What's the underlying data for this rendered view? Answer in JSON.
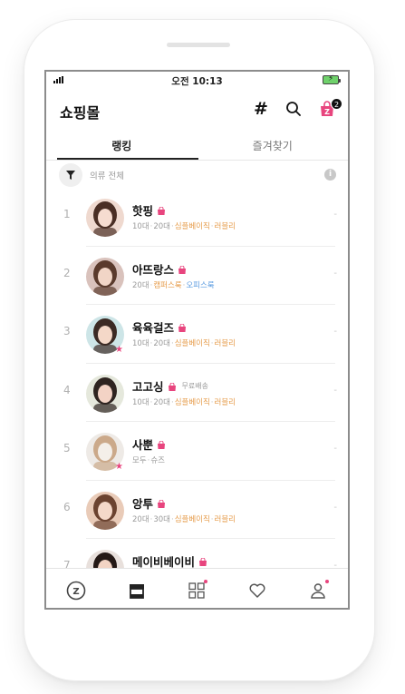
{
  "status_bar": {
    "time": "오전 10:13"
  },
  "header": {
    "title": "쇼핑몰",
    "cart_count": "2"
  },
  "tabs": [
    {
      "label": "랭킹",
      "active": true
    },
    {
      "label": "즐겨찾기",
      "active": false
    }
  ],
  "filter": {
    "label": "의류 전체"
  },
  "stores": [
    {
      "rank": "1",
      "name": "핫핑",
      "free_shipping": "",
      "star": false,
      "tags": [
        {
          "text": "10대",
          "color": "grey"
        },
        {
          "text": "20대",
          "color": "grey"
        },
        {
          "text": "심플베이직",
          "color": "orange"
        },
        {
          "text": "러블리",
          "color": "orange"
        }
      ]
    },
    {
      "rank": "2",
      "name": "아뜨랑스",
      "free_shipping": "",
      "star": false,
      "tags": [
        {
          "text": "20대",
          "color": "grey"
        },
        {
          "text": "캠퍼스룩",
          "color": "orange"
        },
        {
          "text": "오피스룩",
          "color": "blue"
        }
      ]
    },
    {
      "rank": "3",
      "name": "육육걸즈",
      "free_shipping": "",
      "star": true,
      "tags": [
        {
          "text": "10대",
          "color": "grey"
        },
        {
          "text": "20대",
          "color": "grey"
        },
        {
          "text": "심플베이직",
          "color": "orange"
        },
        {
          "text": "러블리",
          "color": "orange"
        }
      ]
    },
    {
      "rank": "4",
      "name": "고고싱",
      "free_shipping": "무료배송",
      "star": false,
      "tags": [
        {
          "text": "10대",
          "color": "grey"
        },
        {
          "text": "20대",
          "color": "grey"
        },
        {
          "text": "심플베이직",
          "color": "orange"
        },
        {
          "text": "러블리",
          "color": "orange"
        }
      ]
    },
    {
      "rank": "5",
      "name": "사뿐",
      "free_shipping": "",
      "star": true,
      "tags": [
        {
          "text": "모두",
          "color": "grey"
        },
        {
          "text": "슈즈",
          "color": "grey"
        }
      ]
    },
    {
      "rank": "6",
      "name": "앙투",
      "free_shipping": "",
      "star": false,
      "tags": [
        {
          "text": "20대",
          "color": "grey"
        },
        {
          "text": "30대",
          "color": "grey"
        },
        {
          "text": "심플베이직",
          "color": "orange"
        },
        {
          "text": "러블리",
          "color": "orange"
        }
      ]
    },
    {
      "rank": "7",
      "name": "메이비베이비",
      "free_shipping": "",
      "star": false,
      "tags": []
    }
  ],
  "row_placeholder": "-",
  "nav": [
    {
      "name": "zigzag-home-icon",
      "dot": false
    },
    {
      "name": "store-icon",
      "dot": false
    },
    {
      "name": "category-grid-icon",
      "dot": true
    },
    {
      "name": "heart-icon",
      "dot": false
    },
    {
      "name": "profile-icon",
      "dot": true
    }
  ],
  "colors": {
    "accent": "#e8457e",
    "tag_orange": "#e69b49",
    "tag_blue": "#5b9be0",
    "tag_grey": "#9a9a9a"
  }
}
